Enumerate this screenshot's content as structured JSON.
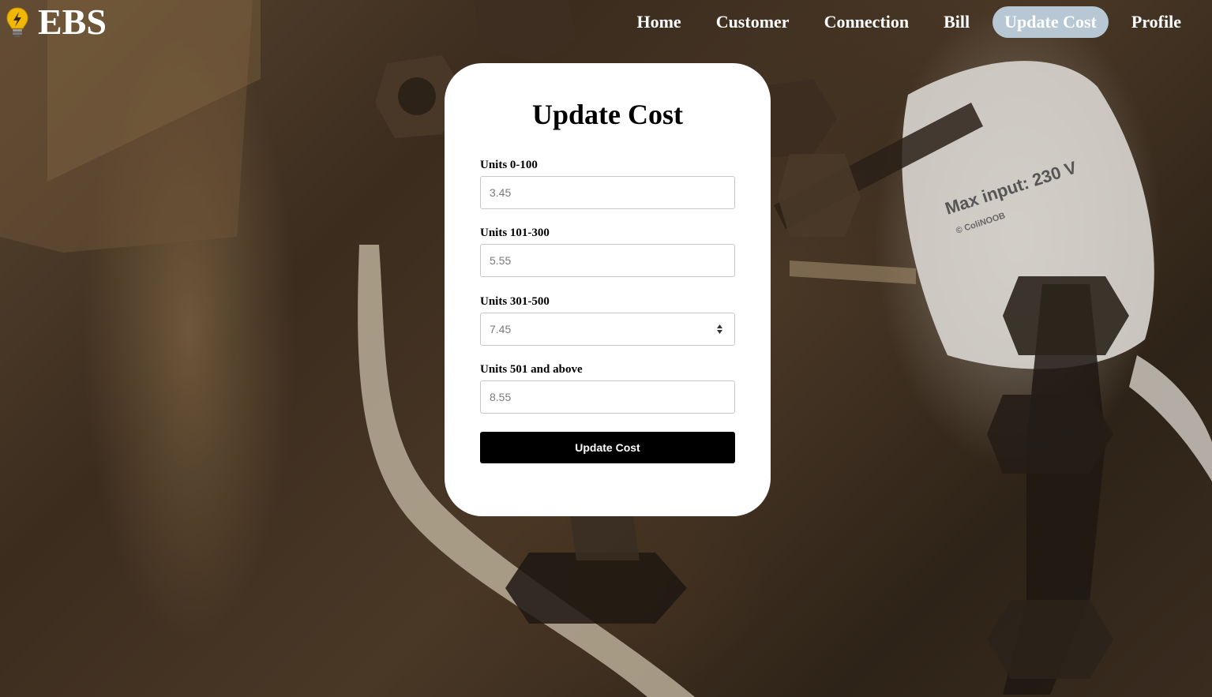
{
  "brand": {
    "name": "EBS",
    "icon": "lightbulb-bolt-icon",
    "icon_color": "#f2b705"
  },
  "nav": {
    "items": [
      {
        "label": "Home",
        "active": false
      },
      {
        "label": "Customer",
        "active": false
      },
      {
        "label": "Connection",
        "active": false
      },
      {
        "label": "Bill",
        "active": false
      },
      {
        "label": "Update Cost",
        "active": true
      },
      {
        "label": "Profile",
        "active": false
      }
    ],
    "active_color": "#b7c7d3"
  },
  "form": {
    "title": "Update Cost",
    "fields": [
      {
        "label": "Units 0-100",
        "placeholder": "3.45"
      },
      {
        "label": "Units 101-300",
        "placeholder": "5.55"
      },
      {
        "label": "Units 301-500",
        "placeholder": "7.45"
      },
      {
        "label": "Units 501 and above",
        "placeholder": "8.55"
      }
    ],
    "submit_label": "Update Cost"
  }
}
